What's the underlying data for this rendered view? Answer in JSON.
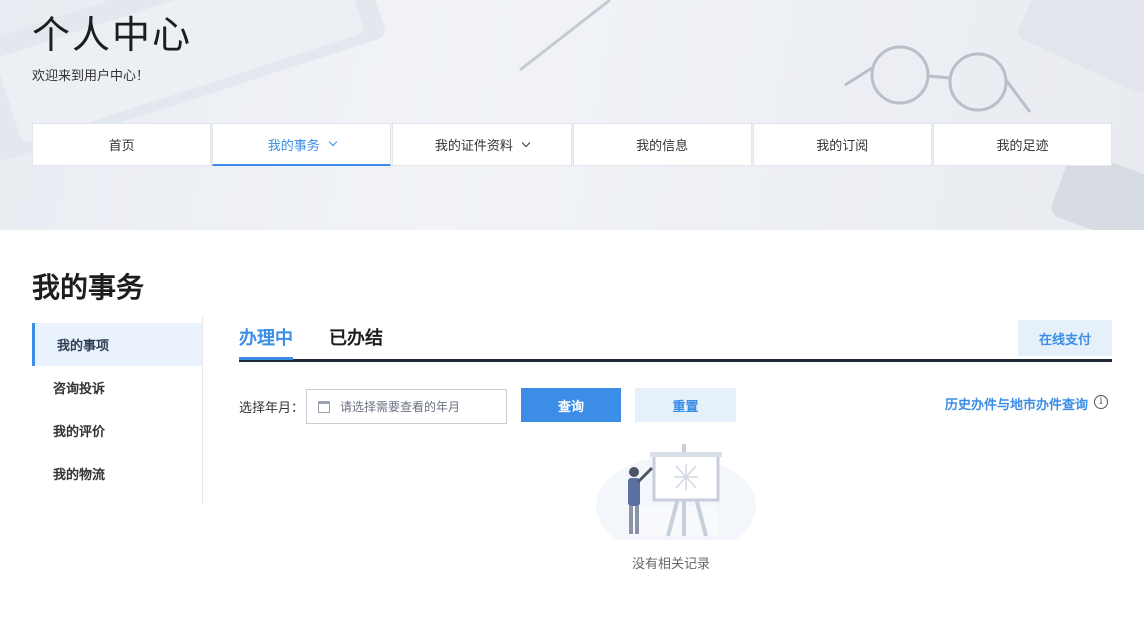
{
  "banner": {
    "title": "个人中心",
    "subtitle": "欢迎来到用户中心！"
  },
  "topnav": {
    "items": [
      {
        "label": "首页"
      },
      {
        "label": "我的事务"
      },
      {
        "label": "我的证件资料"
      },
      {
        "label": "我的信息"
      },
      {
        "label": "我的订阅"
      },
      {
        "label": "我的足迹"
      }
    ],
    "active": "我的事务"
  },
  "main": {
    "title": "我的事务"
  },
  "sidebar": {
    "items": [
      {
        "label": "我的事项"
      },
      {
        "label": "咨询投诉"
      },
      {
        "label": "我的评价"
      },
      {
        "label": "我的物流"
      }
    ]
  },
  "tabs": {
    "items": [
      {
        "label": "办理中"
      },
      {
        "label": "已办结"
      }
    ],
    "pay_label": "在线支付"
  },
  "filter": {
    "label": "选择年月：",
    "placeholder": "请选择需要查看的年月",
    "query_label": "查询",
    "reset_label": "重置",
    "history_link": "历史办件与地市办件查询",
    "info_glyph": "i"
  },
  "empty": {
    "text": "没有相关记录"
  },
  "colors": {
    "accent": "#3b8de6",
    "accent_light": "#e6f0fb",
    "dark_line": "#1f2937"
  },
  "icons": [
    "calendar-icon",
    "chevron-down-icon",
    "info-icon",
    "empty-illustration"
  ]
}
